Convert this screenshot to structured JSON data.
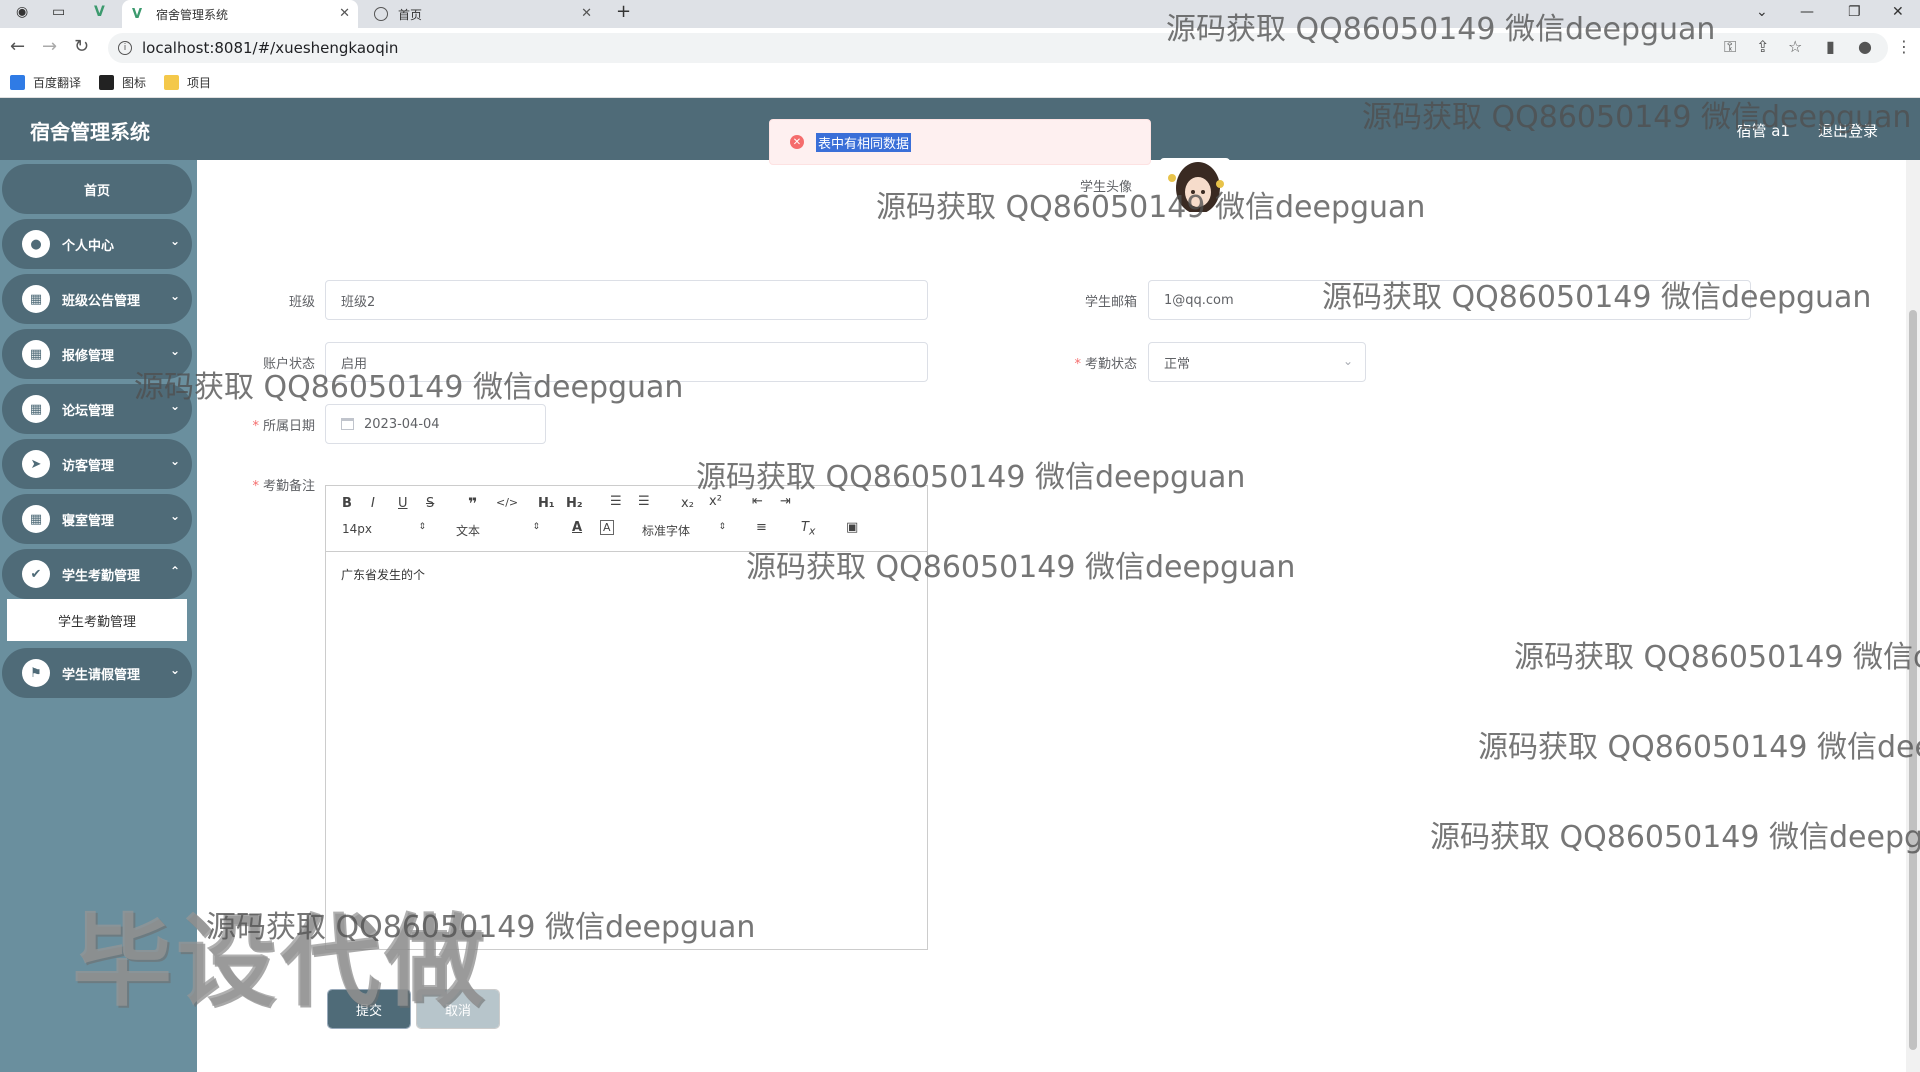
{
  "browser": {
    "tabs": [
      {
        "title": "宿舍管理系统",
        "active": true
      },
      {
        "title": "首页",
        "active": false
      }
    ],
    "new_tab": "+",
    "url": "localhost:8081/#/xueshengkaoqin",
    "bookmarks": [
      "百度翻译",
      "图标",
      "项目"
    ]
  },
  "header": {
    "title": "宿舍管理系统",
    "user": "宿管 a1",
    "logout": "退出登录"
  },
  "toast": {
    "message": "表中有相同数据",
    "type": "error"
  },
  "sidebar": {
    "home": "首页",
    "items": [
      {
        "label": "个人中心",
        "icon": "user-icon"
      },
      {
        "label": "班级公告管理",
        "icon": "grid-icon"
      },
      {
        "label": "报修管理",
        "icon": "grid-icon"
      },
      {
        "label": "论坛管理",
        "icon": "grid-icon"
      },
      {
        "label": "访客管理",
        "icon": "send-icon"
      },
      {
        "label": "寝室管理",
        "icon": "grid-icon"
      },
      {
        "label": "学生考勤管理",
        "icon": "check-icon"
      },
      {
        "label": "学生请假管理",
        "icon": "flag-icon"
      }
    ],
    "submenu": "学生考勤管理"
  },
  "form": {
    "avatar_label": "学生头像",
    "class_label": "班级",
    "class_value": "班级2",
    "email_label": "学生邮箱",
    "email_value": "1@qq.com",
    "account_label": "账户状态",
    "account_value": "启用",
    "attendance_label": "考勤状态",
    "attendance_value": "正常",
    "date_label": "所属日期",
    "date_value": "2023-04-04",
    "remark_label": "考勤备注",
    "remark_content": "广东省发生的个",
    "editor": {
      "font_size": "14px",
      "block_type": "文本",
      "font_family": "标准字体"
    },
    "submit": "提交",
    "cancel": "取消"
  },
  "watermarks": {
    "text": "源码获取 QQ86050149 微信deepguan",
    "big": "毕设代做"
  },
  "colors": {
    "header_bg": "#4f6b78",
    "sidebar_bg": "#6a8f9e",
    "error": "#f56c6c",
    "required": "#f56c6c"
  }
}
